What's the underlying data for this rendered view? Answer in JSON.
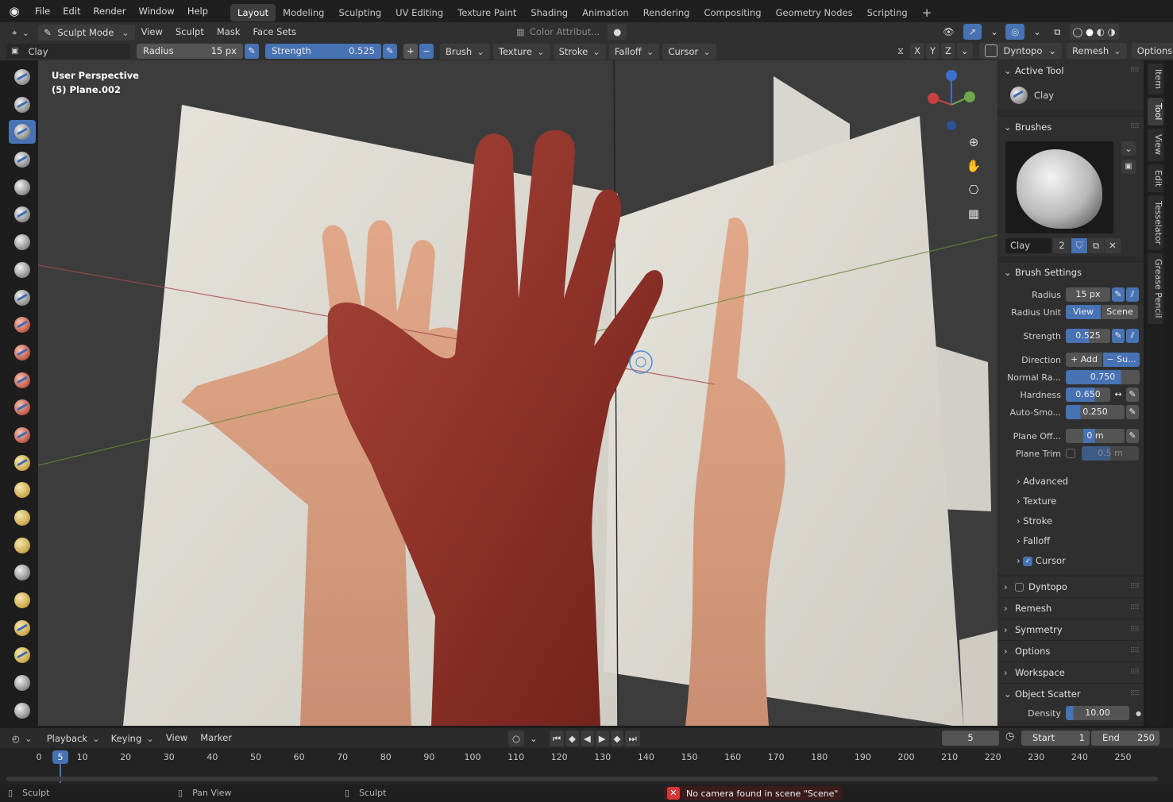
{
  "topbar": {
    "menus": [
      "File",
      "Edit",
      "Render",
      "Window",
      "Help"
    ],
    "workspaces": [
      "Layout",
      "Modeling",
      "Sculpting",
      "UV Editing",
      "Texture Paint",
      "Shading",
      "Animation",
      "Rendering",
      "Compositing",
      "Geometry Nodes",
      "Scripting"
    ],
    "active_workspace": "Layout",
    "add_tab": "+"
  },
  "header": {
    "mode": "Sculpt Mode",
    "menus": [
      "View",
      "Sculpt",
      "Mask",
      "Face Sets"
    ],
    "color_attribute": "Color Attribut...",
    "brush_name": "Clay",
    "radius_label": "Radius",
    "radius_value": "15 px",
    "strength_label": "Strength",
    "strength_value": "0.525",
    "popovers": [
      "Brush",
      "Texture",
      "Stroke",
      "Falloff",
      "Cursor"
    ],
    "axes": [
      "X",
      "Y",
      "Z"
    ],
    "dyntopo": "Dyntopo",
    "remesh": "Remesh",
    "options": "Options"
  },
  "viewport": {
    "perspective": "User Perspective",
    "object": "(5) Plane.002",
    "gizmo_axes": [
      "Y",
      "X",
      "Z"
    ]
  },
  "npanel": {
    "tabs": [
      "Item",
      "Tool",
      "View",
      "Edit",
      "Tesselator",
      "Grease Pencil"
    ],
    "active_tab": "Tool",
    "active_tool_title": "Active Tool",
    "active_tool_name": "Clay",
    "brushes_title": "Brushes",
    "brush_name": "Clay",
    "brush_users": "2",
    "brush_settings_title": "Brush Settings",
    "radius_label": "Radius",
    "radius_value": "15 px",
    "radius_unit_label": "Radius Unit",
    "radius_unit_view": "View",
    "radius_unit_scene": "Scene",
    "strength_label": "Strength",
    "strength_value": "0.525",
    "strength_fraction": 0.525,
    "direction_label": "Direction",
    "direction_add": "Add",
    "direction_sub": "Su...",
    "normal_radius_label": "Normal Ra...",
    "normal_radius_value": "0.750",
    "hardness_label": "Hardness",
    "hardness_value": "0.650",
    "autosmooth_label": "Auto-Smo...",
    "autosmooth_value": "0.250",
    "plane_offset_label": "Plane Off...",
    "plane_offset_value": "0 m",
    "plane_trim_label": "Plane Trim",
    "plane_trim_value": "0.5 m",
    "subpanels": [
      "Advanced",
      "Texture",
      "Stroke",
      "Falloff",
      "Cursor"
    ],
    "sections": [
      "Dyntopo",
      "Remesh",
      "Symmetry",
      "Options",
      "Workspace",
      "Object Scatter"
    ],
    "density_label": "Density",
    "density_value": "10.00"
  },
  "timeline": {
    "menus": [
      "Playback",
      "Keying",
      "View",
      "Marker"
    ],
    "current_frame": "5",
    "start_label": "Start",
    "start_value": "1",
    "end_label": "End",
    "end_value": "250",
    "ticks": [
      "0",
      "10",
      "20",
      "30",
      "40",
      "50",
      "60",
      "70",
      "80",
      "90",
      "100",
      "110",
      "120",
      "130",
      "140",
      "150",
      "160",
      "170",
      "180",
      "190",
      "200",
      "210",
      "220",
      "230",
      "240",
      "250"
    ]
  },
  "statusbar": {
    "left": "Sculpt",
    "middle": "Pan View",
    "right": "Sculpt",
    "error": "No camera found in scene \"Scene\""
  }
}
